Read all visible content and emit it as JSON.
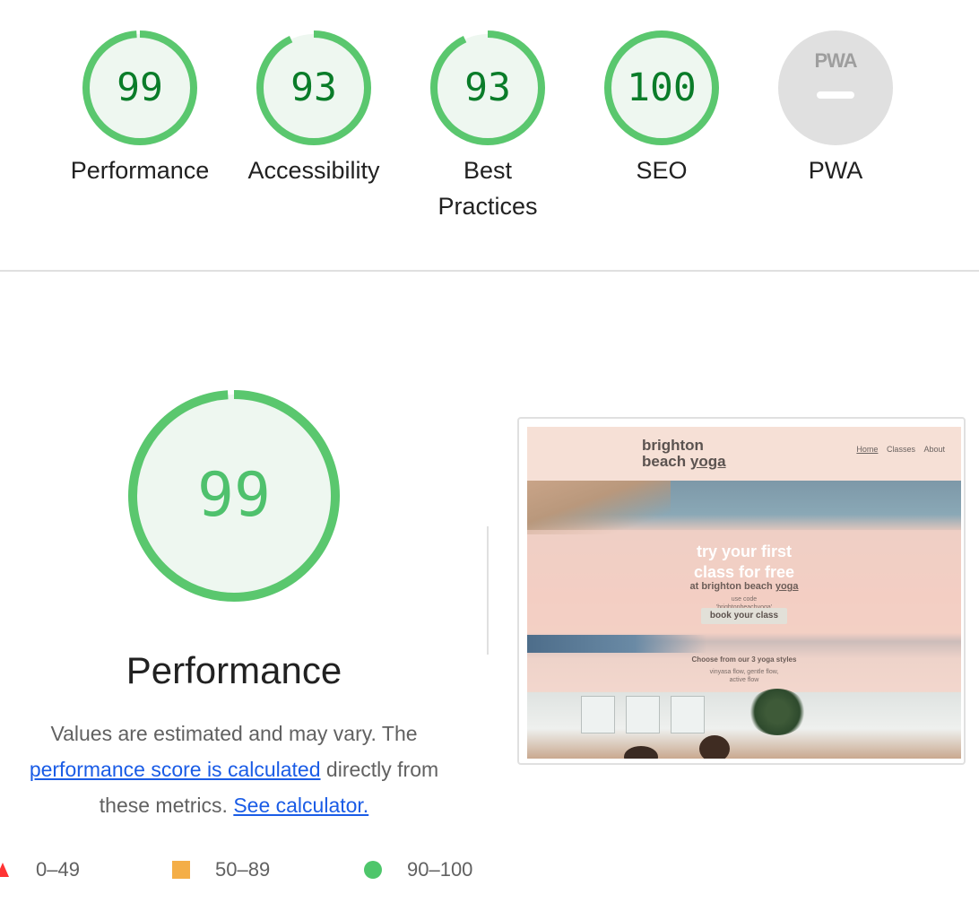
{
  "scores": [
    {
      "label": "Performance",
      "value": "99",
      "fraction": 0.99
    },
    {
      "label": "Accessibility",
      "value": "93",
      "fraction": 0.93
    },
    {
      "label": "Best\nPractices",
      "value": "93",
      "fraction": 0.93
    },
    {
      "label": "SEO",
      "value": "100",
      "fraction": 1.0
    },
    {
      "label": "PWA",
      "badge": "PWA",
      "value": null
    }
  ],
  "detail": {
    "score": "99",
    "fraction": 0.99,
    "title": "Performance",
    "desc_before": "Values are estimated and may vary. The",
    "desc_link1": "performance score is calculated",
    "desc_middle": "directly from these metrics.",
    "desc_link2": "See calculator."
  },
  "legend": [
    {
      "range": "0–49",
      "shape": "triangle",
      "color": "#f33"
    },
    {
      "range": "50–89",
      "shape": "square",
      "color": "#ffaa33"
    },
    {
      "range": "90–100",
      "shape": "circle",
      "color": "#0cce6b"
    }
  ],
  "colors": {
    "pass_ring": "#5ac76e",
    "pass_fill": "#eef7f0",
    "pass_text": "#0a7c29",
    "na_fill": "#e0e0e0",
    "link": "#1a5ce6"
  },
  "screenshot": {
    "logo_line1": "brighton",
    "logo_line2a": "beach",
    "logo_line2b": "yoga",
    "nav": [
      "Home",
      "Classes",
      "About"
    ],
    "hero_line1": "try your first",
    "hero_line2": "class for free",
    "hero_sub_a": "at brighton beach",
    "hero_sub_b": "yoga",
    "code_line1": "use code",
    "code_line2": "'brightonbeachyoga'",
    "button": "book your class",
    "styles_title": "Choose from our 3 yoga styles",
    "styles_line1": "vinyasa flow, gentle flow,",
    "styles_line2": "active flow"
  }
}
